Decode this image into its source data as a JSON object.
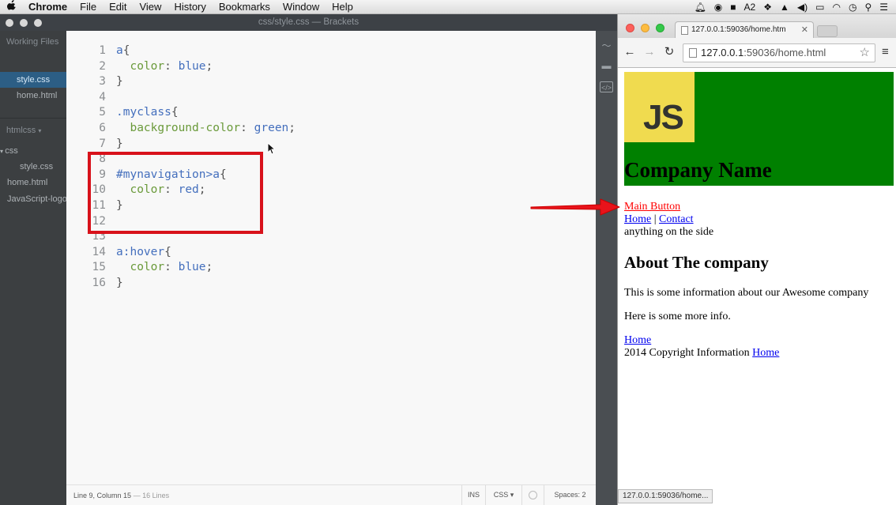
{
  "menubar": {
    "apple": "",
    "items": [
      "Chrome",
      "File",
      "Edit",
      "View",
      "History",
      "Bookmarks",
      "Window",
      "Help"
    ],
    "status_badge": "2"
  },
  "brackets": {
    "title": "css/style.css — Brackets",
    "sidebar": {
      "working_files_label": "Working Files",
      "working_files": [
        "style.css",
        "home.html"
      ],
      "selected_file": "style.css",
      "project_name": "htmlcss",
      "tree": [
        {
          "label": "css",
          "indent": 0,
          "is_folder": true
        },
        {
          "label": "style.css",
          "indent": 1,
          "is_folder": false
        },
        {
          "label": "home.html",
          "indent": 0,
          "is_folder": false
        },
        {
          "label": "JavaScript-logo",
          "indent": 0,
          "is_folder": false
        }
      ]
    },
    "code_lines": [
      "a{",
      "  color: blue;",
      "}",
      "",
      ".myclass{",
      "  background-color: green;",
      "}",
      "",
      "#mynavigation>a{",
      "  color: red;",
      "}",
      "",
      "",
      "a:hover{",
      "  color: blue;",
      "}"
    ],
    "statusbar": {
      "position": "Line 9, Column 15",
      "lines": "— 16 Lines",
      "mode": "INS",
      "language": "CSS",
      "spaces": "Spaces: 2"
    }
  },
  "chrome": {
    "tab_title": "127.0.0.1:59036/home.htm",
    "url_host": "127.0.0.1",
    "url_rest": ":59036/home.html",
    "status_url": "127.0.0.1:59036/home...",
    "page": {
      "logo_text": "JS",
      "company_name": "Company Name",
      "main_button": "Main Button",
      "nav_home": "Home",
      "nav_sep": " | ",
      "nav_contact": "Contact",
      "side_text": "anything on the side",
      "about_heading": "About The company",
      "info1": "This is some information about our Awesome company",
      "info2": "Here is some more info.",
      "footer_home": "Home",
      "copyright": "2014 Copyright Information ",
      "copyright_link": "Home"
    }
  },
  "colors": {
    "highlight_box": "#d8121b",
    "arrow": "#e8131b",
    "hero_bg": "#008000",
    "js_logo_bg": "#f0db4f",
    "main_button": "#ff0000"
  }
}
